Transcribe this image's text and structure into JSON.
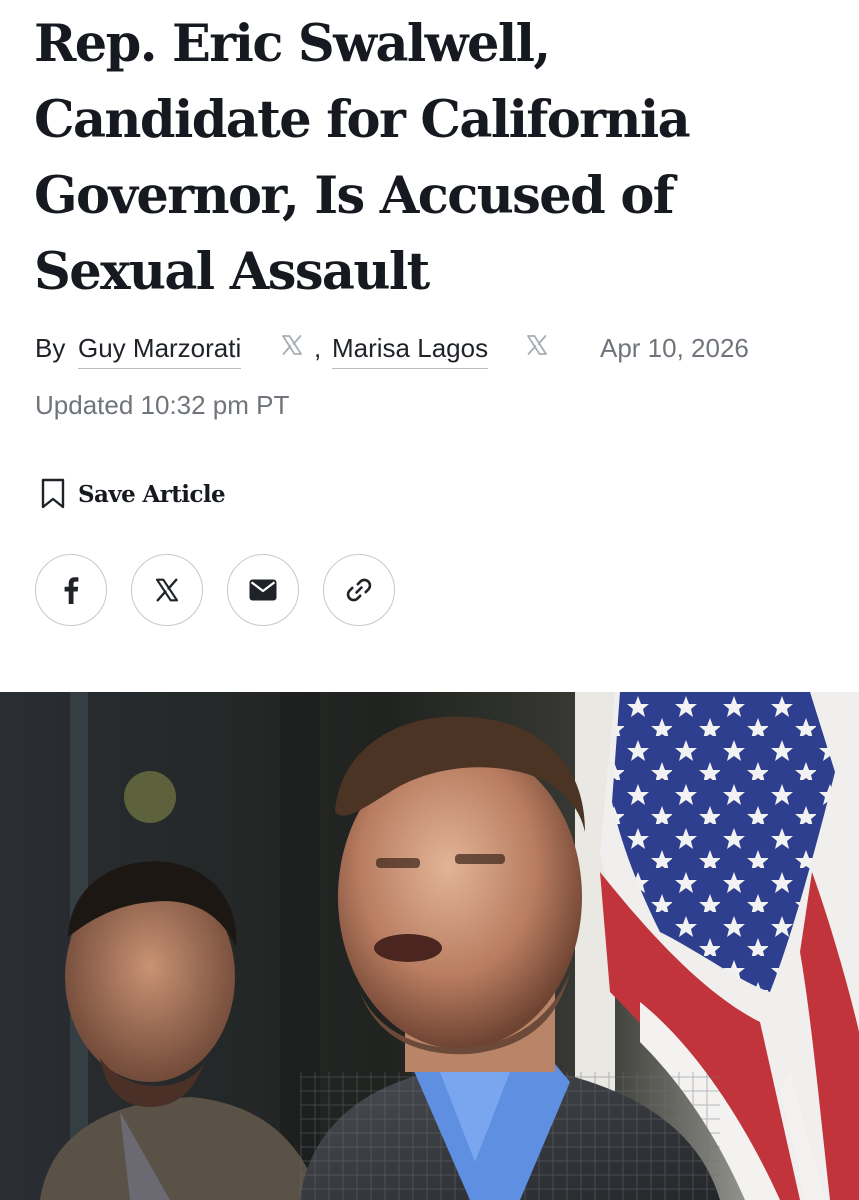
{
  "article": {
    "headline_lines": [
      "Rep. Eric Swalwell,",
      "Candidate for California",
      "Governor, Is Accused of",
      "Sexual Assault"
    ],
    "byline": {
      "prefix": "By",
      "authors": [
        "Guy Marzorati",
        "Marisa Lagos"
      ],
      "separator": ",",
      "author_social_icon": "x-logo-icon"
    },
    "date": "Apr 10, 2026",
    "updated": "Updated 10:32 pm PT"
  },
  "actions": {
    "save_label": "Save Article",
    "save_icon": "bookmark-icon"
  },
  "share_buttons": [
    {
      "icon": "facebook-icon",
      "label": "Facebook"
    },
    {
      "icon": "x-logo-icon",
      "label": "X"
    },
    {
      "icon": "email-icon",
      "label": "Email"
    },
    {
      "icon": "link-icon",
      "label": "Copy link"
    }
  ],
  "hero_image": {
    "subject": "photo-of-speaker-with-american-flag"
  },
  "colors": {
    "headline": "#16191f",
    "text": "#1f2328",
    "muted": "#70757b",
    "border": "#c6c9cd",
    "underline": "#b9bdc3"
  }
}
